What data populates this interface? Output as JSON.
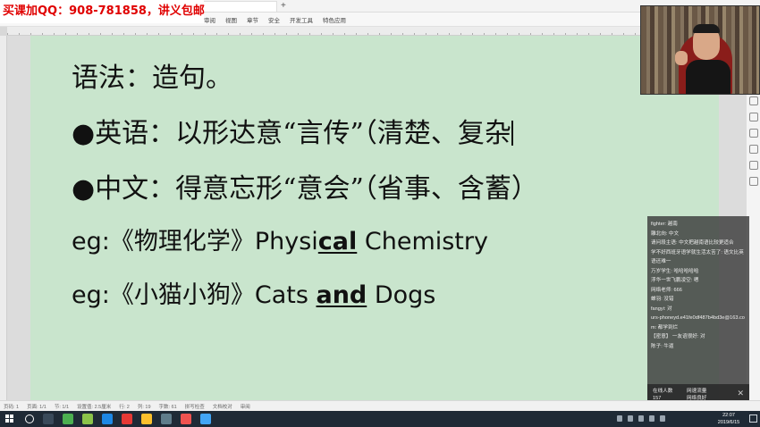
{
  "promo": {
    "text": "买课加QQ：908-781858，讲义包邮"
  },
  "titlebar": {
    "new_tab": "+"
  },
  "ribbon": {
    "items": [
      "审阅",
      "视图",
      "章节",
      "安全",
      "开发工具",
      "特色应用"
    ]
  },
  "document": {
    "line1": "语法：造句。",
    "line2_bullet": "●",
    "line2_text": "英语：以形达意“言传”（清楚、复杂",
    "line3_bullet": "●",
    "line3_text": "中文：得意忘形“意会”（省事、含蓄）",
    "line4_prefix": "eg:《物理化学》Physi",
    "line4_emph": "cal",
    "line4_suffix": " Chemistry",
    "line5_prefix": "eg:《小猫小狗》Cats ",
    "line5_emph": "and",
    "line5_suffix": " Dogs"
  },
  "chat": {
    "messages": [
      "fighter: 越南",
      "雕北向: 中文",
      "请问段主语: 中文把越南语比较更适合",
      "学不好西班牙语学就生活太苦了: 语文比英语还难一",
      "万岁学生: 哈哈哈哈哈",
      "浮华一世飞鹏凌空: 嗯",
      "网络老师: 666",
      "蝉羽: 没错",
      "fangyi: 对",
      "urs-phoneyd.e41fe0df487b4bd3e@163.com: 都学到烂",
      "【密意】 一友谊很好: 对",
      "陈子: 牛逼"
    ],
    "footer_label_a": "在线人数",
    "footer_value_a": "157",
    "footer_label_b": "网速流量",
    "footer_value_b": "网络良好",
    "close": "✕"
  },
  "status": {
    "items": [
      "页码: 1",
      "页面: 1/1",
      "节: 1/1",
      "设置值: 2.5厘米",
      "行: 2",
      "列: 19",
      "字数: 61",
      "拼写检查",
      "文档校对",
      "审阅"
    ]
  },
  "taskbar": {
    "time": "22:07",
    "date": "2019/6/15"
  },
  "colors": {
    "page_bg": "#c9e5cd",
    "promo_text": "#e00000",
    "taskbar_bg": "#1f2a36"
  }
}
